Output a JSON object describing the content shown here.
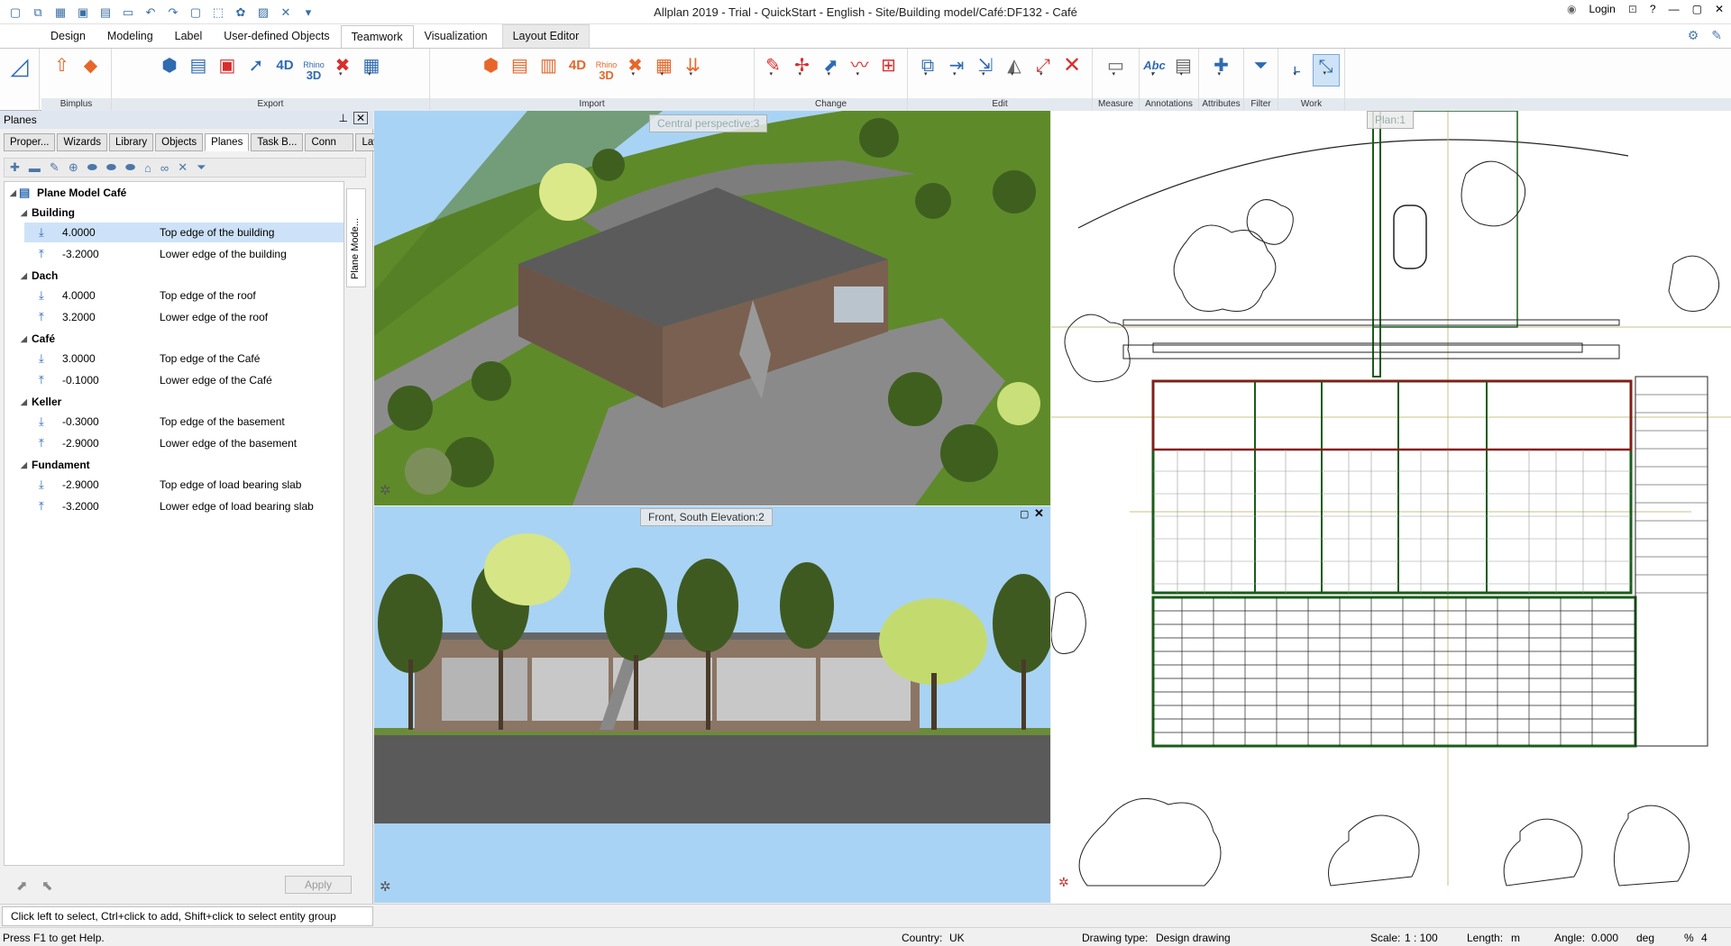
{
  "window": {
    "title": "Allplan 2019 - Trial - QuickStart - English - Site/Building model/Café:DF132 - Café",
    "login_label": "Login",
    "help_label": "?"
  },
  "menu_tabs": [
    {
      "label": "Design"
    },
    {
      "label": "Modeling"
    },
    {
      "label": "Label"
    },
    {
      "label": "User-defined Objects"
    },
    {
      "label": "Teamwork"
    },
    {
      "label": "Visualization"
    },
    {
      "label": "Layout Editor"
    }
  ],
  "ribbon": {
    "groups": [
      {
        "label": "Bimplus"
      },
      {
        "label": "Export"
      },
      {
        "label": "Import"
      },
      {
        "label": "Change"
      },
      {
        "label": "Edit"
      },
      {
        "label": "Measure"
      },
      {
        "label": "Annotations"
      },
      {
        "label": "Attributes"
      },
      {
        "label": "Filter"
      },
      {
        "label": "Work Environment"
      }
    ],
    "icon_texts": {
      "four_d": "4D",
      "rhino": "Rhino",
      "three_d": "3D",
      "abc": "Abc"
    }
  },
  "left_panel": {
    "title": "Planes",
    "tabs": [
      {
        "label": "Proper..."
      },
      {
        "label": "Wizards"
      },
      {
        "label": "Library"
      },
      {
        "label": "Objects"
      },
      {
        "label": "Planes"
      },
      {
        "label": "Task B..."
      },
      {
        "label": "Conn"
      },
      {
        "label": "Layers"
      }
    ],
    "vertical_tab": "Plane Mode...",
    "tree": {
      "root": "Plane Model Café",
      "groups": [
        {
          "name": "Building",
          "planes": [
            {
              "value": "4.0000",
              "desc": "Top edge of the building",
              "dir": "down"
            },
            {
              "value": "-3.2000",
              "desc": "Lower edge of the building",
              "dir": "up"
            }
          ]
        },
        {
          "name": "Dach",
          "planes": [
            {
              "value": "4.0000",
              "desc": "Top edge of the roof",
              "dir": "down"
            },
            {
              "value": "3.2000",
              "desc": "Lower edge of the roof",
              "dir": "up"
            }
          ]
        },
        {
          "name": "Café",
          "planes": [
            {
              "value": "3.0000",
              "desc": "Top edge of the Café",
              "dir": "down"
            },
            {
              "value": "-0.1000",
              "desc": "Lower edge of the Café",
              "dir": "up"
            }
          ]
        },
        {
          "name": "Keller",
          "planes": [
            {
              "value": "-0.3000",
              "desc": "Top edge of the basement",
              "dir": "down"
            },
            {
              "value": "-2.9000",
              "desc": "Lower edge of the basement",
              "dir": "up"
            }
          ]
        },
        {
          "name": "Fundament",
          "planes": [
            {
              "value": "-2.9000",
              "desc": "Top edge of load bearing slab",
              "dir": "down"
            },
            {
              "value": "-3.2000",
              "desc": "Lower edge of load bearing slab",
              "dir": "up"
            }
          ]
        }
      ]
    },
    "apply_label": "Apply"
  },
  "viewports": {
    "perspective_label": "Central perspective:3",
    "elevation_label": "Front, South Elevation:2",
    "plan_label": "Plan:1"
  },
  "hint": "Click left to select, Ctrl+click to add, Shift+click to select entity group",
  "status": {
    "help": "Press F1 to get Help.",
    "country_label": "Country:",
    "country_value": "UK",
    "drawing_type_label": "Drawing type:",
    "drawing_type_value": "Design drawing",
    "scale_label": "Scale:",
    "scale_value": "1 : 100",
    "length_label": "Length:",
    "length_value": "m",
    "angle_label": "Angle:",
    "angle_value": "0.000",
    "angle_unit": "deg",
    "percent_label": "%",
    "percent_value": "4"
  },
  "colors": {
    "accent": "#2f6bb1",
    "selection": "#cde2f8",
    "sky": "#a9d3f4",
    "grass": "#5f8a2a",
    "roof": "#5b5b5b",
    "asphalt": "#6e6e6e"
  }
}
